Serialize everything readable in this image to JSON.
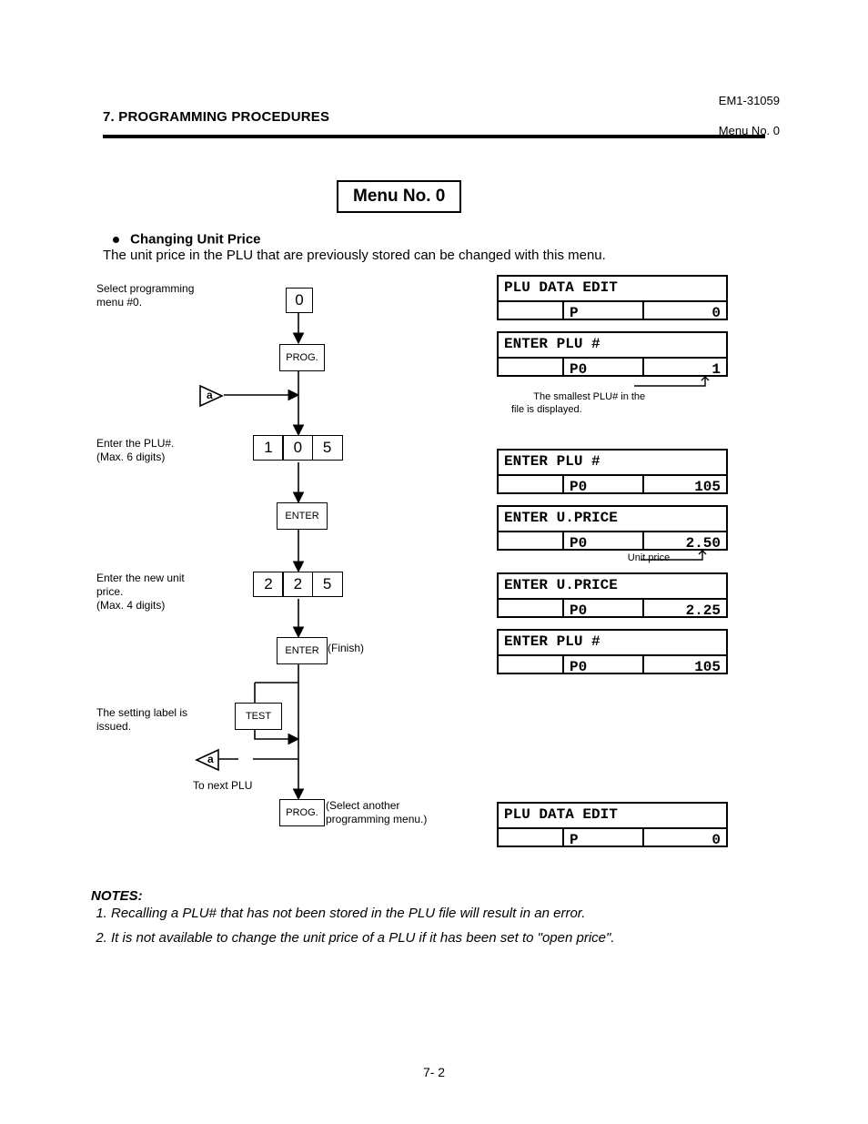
{
  "header": {
    "section": "7. PROGRAMMING PROCEDURES",
    "doccode": "EM1-31059",
    "submenu": "Menu No. 0"
  },
  "title": "Menu No. 0",
  "bullet": "Changing Unit Price",
  "intro": "The unit price in the PLU that are previously stored can be changed with this menu.",
  "flow": {
    "cap_select": "Select programming\nmenu #0.",
    "btn0": "0",
    "prog": "PROG.",
    "loop_a1": "a",
    "cap_plu": "Enter the PLU#.\n(Max. 6 digits)",
    "plu_digits": [
      "1",
      "0",
      "5"
    ],
    "enter1": "ENTER",
    "cap_price": "Enter the new unit\nprice.\n(Max. 4 digits)",
    "price_digits": [
      "2",
      "2",
      "5"
    ],
    "enter2": "ENTER",
    "finish": "(Finish)",
    "cap_label": "The setting label is\nissued.",
    "test": "TEST",
    "loop_a2": "a",
    "to_next": "To next PLU",
    "prog2": "PROG.",
    "select_another": "(Select another\nprogramming menu.)"
  },
  "displays": {
    "d1": {
      "l1": "PLU DATA EDIT",
      "c2": "P",
      "c3": "0"
    },
    "d2": {
      "l1": "ENTER PLU #",
      "c2": "P0",
      "c3": "1",
      "note": "The smallest PLU# in the\nfile is displayed."
    },
    "d3": {
      "l1": "ENTER PLU #",
      "c2": "P0",
      "c3": "105"
    },
    "d4": {
      "l1": "ENTER U.PRICE",
      "c2": "P0",
      "c3": "2.50",
      "note": "Unit price"
    },
    "d5": {
      "l1": "ENTER U.PRICE",
      "c2": "P0",
      "c3": "2.25"
    },
    "d6": {
      "l1": "ENTER PLU #",
      "c2": "P0",
      "c3": "105"
    },
    "d7": {
      "l1": "PLU DATA EDIT",
      "c2": "P",
      "c3": "0"
    }
  },
  "notes": {
    "head": "NOTES:",
    "n1": "Recalling a PLU# that has not been stored in the PLU file will result in an error.",
    "n2": "It is not available to change the unit price of a PLU if it has been set to \"open price\"."
  },
  "page": "7- 2"
}
